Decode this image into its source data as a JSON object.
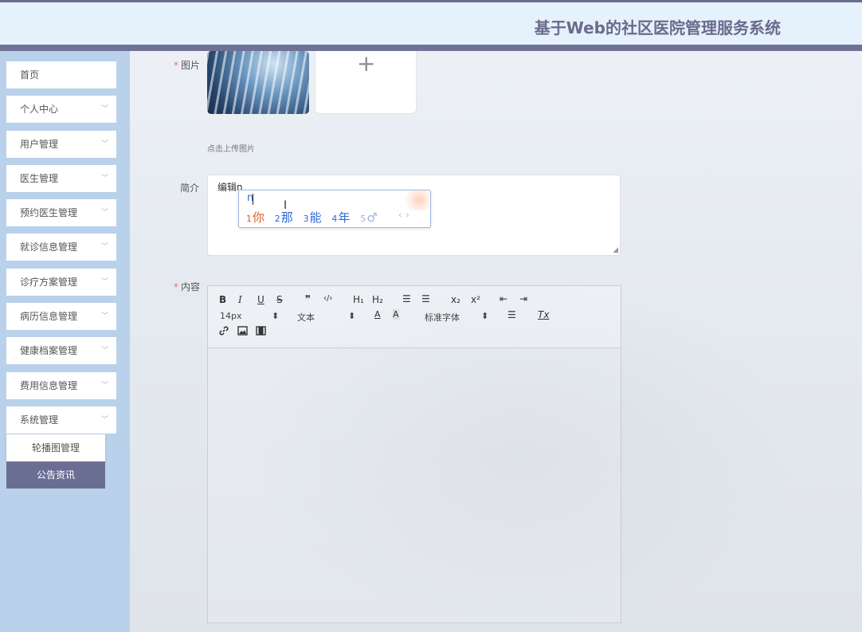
{
  "app": {
    "title": "基于Web的社区医院管理服务系统"
  },
  "colors": {
    "header_bar": "#6f7196",
    "sidebar": "#b9d1ea",
    "submenu_active_bg": "#6b6e93",
    "required_star": "#f56c6c",
    "ime_first": "#e35a25",
    "ime_other": "#2d6ad5"
  },
  "sidebar": {
    "items": [
      {
        "label": "首页",
        "has_children": false
      },
      {
        "label": "个人中心",
        "has_children": true
      },
      {
        "label": "用户管理",
        "has_children": true
      },
      {
        "label": "医生管理",
        "has_children": true
      },
      {
        "label": "预约医生管理",
        "has_children": true
      },
      {
        "label": "就诊信息管理",
        "has_children": true
      },
      {
        "label": "诊疗方案管理",
        "has_children": true
      },
      {
        "label": "病历信息管理",
        "has_children": true
      },
      {
        "label": "健康档案管理",
        "has_children": true
      },
      {
        "label": "费用信息管理",
        "has_children": true
      },
      {
        "label": "系统管理",
        "has_children": true,
        "expanded": true
      }
    ],
    "submenu": [
      {
        "label": "轮播图管理",
        "active": false
      },
      {
        "label": "公告资讯",
        "active": true
      }
    ]
  },
  "form": {
    "image": {
      "label": "图片",
      "required": true,
      "hint": "点击上传图片",
      "add_icon": "plus-icon"
    },
    "intro": {
      "label": "简介",
      "value": "编辑n"
    },
    "content": {
      "label": "内容",
      "required": true
    }
  },
  "ime": {
    "composition": "n",
    "candidates": [
      {
        "index": "1",
        "text": "你"
      },
      {
        "index": "2",
        "text": "那"
      },
      {
        "index": "3",
        "text": "能"
      },
      {
        "index": "4",
        "text": "年"
      },
      {
        "index": "5",
        "text": "♂"
      }
    ],
    "prev": "‹",
    "next": "›"
  },
  "editor": {
    "toolbar": {
      "bold": "B",
      "italic": "I",
      "underline": "U",
      "strike": "S",
      "blockquote": "❞",
      "code": "‹/›",
      "h1": "H₁",
      "h2": "H₂",
      "ordered_list": "☰",
      "bullet_list": "☰",
      "subscript": "x₂",
      "superscript": "x²",
      "indent_minus": "⇤",
      "indent_plus": "⇥",
      "size": "14px",
      "text_type": "文本",
      "font": "标准字体",
      "color": "A",
      "background": "A",
      "align": "☰",
      "clean": "Tx",
      "link_icon": "link-icon",
      "image_icon": "image-icon",
      "video_icon": "video-icon"
    }
  }
}
